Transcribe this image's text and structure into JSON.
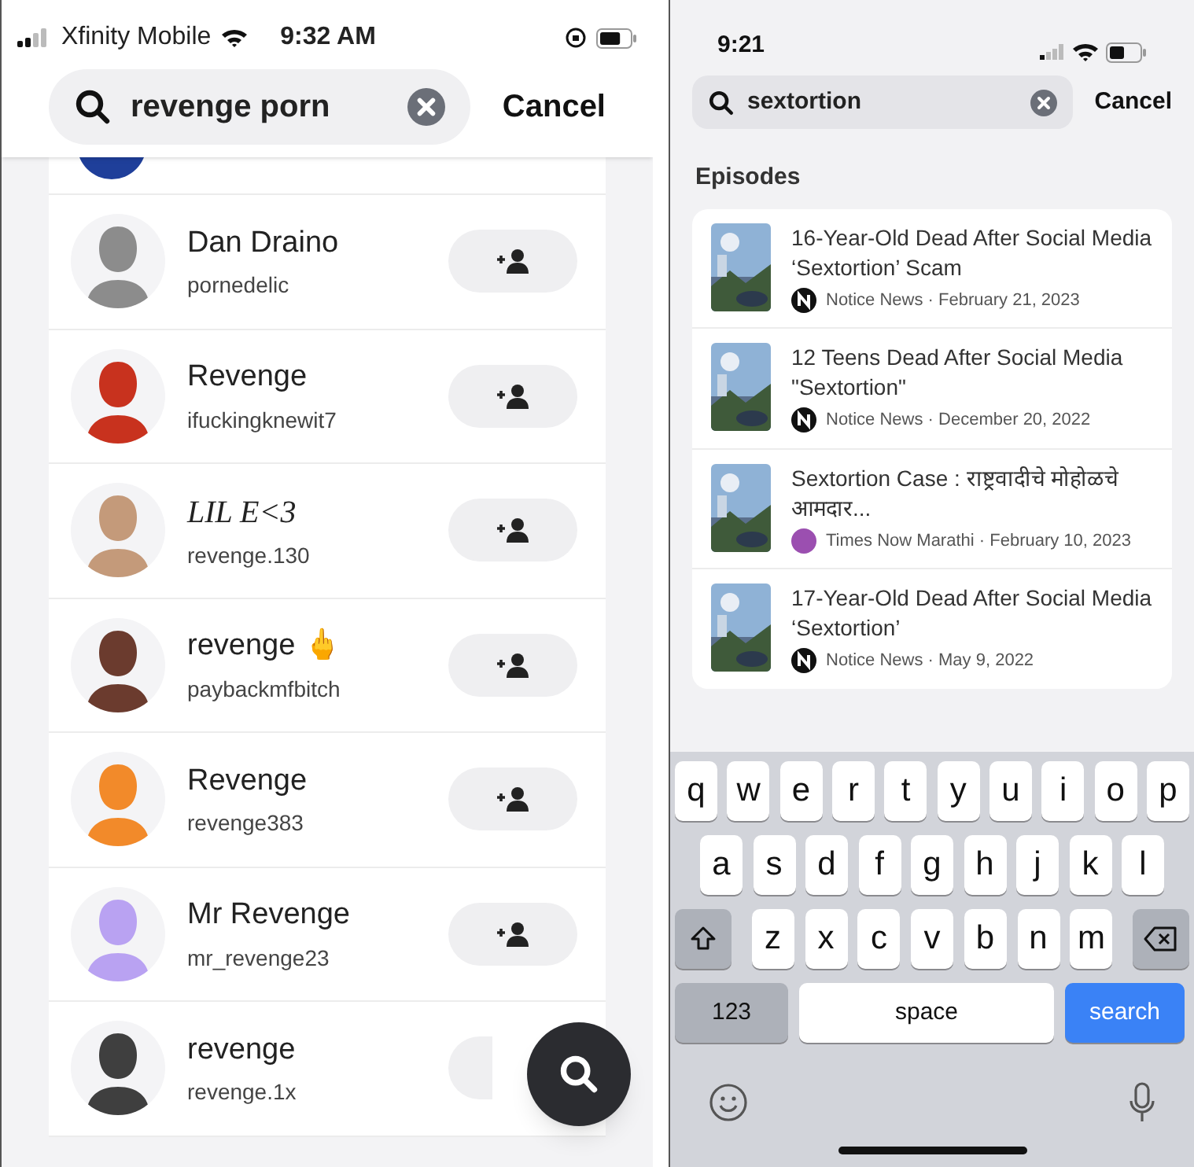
{
  "left_phone": {
    "status_bar": {
      "carrier": "Xfinity Mobile",
      "time": "9:32 AM"
    },
    "search": {
      "value": "revenge porn",
      "cancel": "Cancel"
    },
    "results": [
      {
        "name": "Dan Draino",
        "username": "pornedelic",
        "color": "#8c8c8c",
        "fancy_name": false,
        "add_button_covered": false
      },
      {
        "name": "Revenge",
        "username": "ifuckingknewit7",
        "color": "#c8321e",
        "fancy_name": false,
        "add_button_covered": false
      },
      {
        "name": "LIL E<3",
        "username": "revenge.130",
        "color": "#c49a7a",
        "fancy_name": true,
        "add_button_covered": false
      },
      {
        "name": "revenge 🖕",
        "username": "paybackmfbitch",
        "color": "#6b3b2e",
        "fancy_name": false,
        "add_button_covered": false
      },
      {
        "name": "Revenge",
        "username": "revenge383",
        "color": "#f28a2a",
        "fancy_name": false,
        "add_button_covered": false
      },
      {
        "name": "Mr Revenge",
        "username": "mr_revenge23",
        "color": "#b9a2f2",
        "fancy_name": false,
        "add_button_covered": false
      },
      {
        "name": "revenge",
        "username": "revenge.1x",
        "color": "#3f3f3f",
        "fancy_name": false,
        "add_button_covered": true
      }
    ]
  },
  "right_phone": {
    "status_bar": {
      "time": "9:21"
    },
    "search": {
      "value": "sextortion",
      "cancel": "Cancel"
    },
    "section_title": "Episodes",
    "episodes": [
      {
        "title": "16-Year-Old Dead After Social Media ‘Sextortion’ Scam",
        "byline": "Notice News · February 21, 2023",
        "color": "#111111",
        "kind": "picture"
      },
      {
        "title": "12 Teens Dead After Social Media \"Sextortion\"",
        "byline": "Notice News · December 20, 2022",
        "color": "#111111",
        "kind": "picture"
      },
      {
        "title": "Sextortion Case : राष्ट्रवादीचे मोहोळचे आमदार...",
        "byline": "Times Now Marathi · February 10, 2023",
        "color": "#9b4fb0",
        "kind": "picture"
      },
      {
        "title": "17-Year-Old Dead After Social Media ‘Sextortion’",
        "byline": "Notice News · May 9, 2022",
        "color": "#111111",
        "kind": "picture"
      }
    ],
    "keyboard": {
      "letter_rows": [
        [
          "q",
          "w",
          "e",
          "r",
          "t",
          "y",
          "u",
          "i",
          "o",
          "p"
        ],
        [
          "a",
          "s",
          "d",
          "f",
          "g",
          "h",
          "j",
          "k",
          "l"
        ],
        [
          "z",
          "x",
          "c",
          "v",
          "b",
          "n",
          "m"
        ]
      ],
      "mode_key": "123",
      "space_key": "space",
      "action_key": "search"
    }
  }
}
